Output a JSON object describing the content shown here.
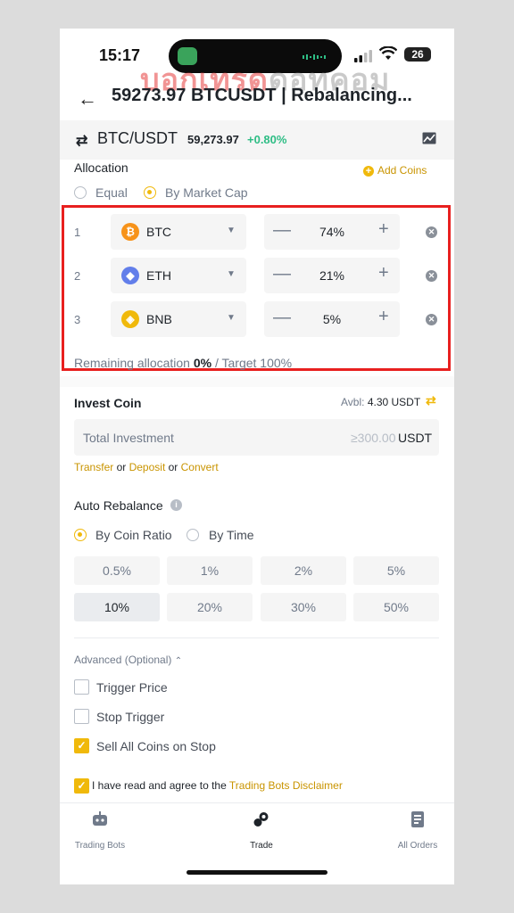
{
  "status_bar": {
    "time": "15:17",
    "battery": "26"
  },
  "watermark": {
    "part1": "บอกเทรด",
    "part2": "ดอทคอม"
  },
  "header": {
    "back_icon": "arrow-left-icon",
    "title": "59273.97 BTCUSDT | Rebalancing..."
  },
  "pair": {
    "name": "BTC/USDT",
    "price": "59,273.97",
    "change": "+0.80%"
  },
  "allocation": {
    "label": "Allocation",
    "add_coins": "Add Coins",
    "modes": [
      {
        "label": "Equal",
        "selected": false
      },
      {
        "label": "By Market Cap",
        "selected": true
      }
    ],
    "rows": [
      {
        "index": "1",
        "coin": "BTC",
        "symbol": "₿",
        "color": "#f7931a",
        "percent": "74%"
      },
      {
        "index": "2",
        "coin": "ETH",
        "symbol": "◆",
        "color": "#627eea",
        "percent": "21%"
      },
      {
        "index": "3",
        "coin": "BNB",
        "symbol": "◈",
        "color": "#f0b90b",
        "percent": "5%"
      }
    ],
    "remaining_prefix": "Remaining allocation",
    "remaining_value": "0%",
    "remaining_suffix": "/ Target 100%"
  },
  "invest": {
    "label": "Invest Coin",
    "avbl_label": "Avbl:",
    "avbl_value": "4.30 USDT",
    "placeholder": "Total Investment",
    "minimum": "≥300.00",
    "unit": "USDT",
    "link_transfer": "Transfer",
    "or1": "or",
    "link_deposit": "Deposit",
    "or2": "or",
    "link_convert": "Convert"
  },
  "auto_rebalance": {
    "label": "Auto Rebalance",
    "modes": [
      {
        "label": "By Coin Ratio",
        "selected": true
      },
      {
        "label": "By Time",
        "selected": false
      }
    ],
    "ratios": [
      "0.5%",
      "1%",
      "2%",
      "5%",
      "10%",
      "20%",
      "30%",
      "50%"
    ],
    "selected_ratio": "10%"
  },
  "advanced": {
    "label": "Advanced (Optional)",
    "options": [
      {
        "label": "Trigger Price",
        "checked": false
      },
      {
        "label": "Stop Trigger",
        "checked": false
      },
      {
        "label": "Sell All Coins on Stop",
        "checked": true
      }
    ]
  },
  "agreement": {
    "text": "I have read and agree to the",
    "link": "Trading Bots Disclaimer",
    "checked": true
  },
  "tabs": [
    {
      "label": "Trading Bots",
      "icon": "robot-icon"
    },
    {
      "label": "Trade",
      "icon": "trade-icon"
    },
    {
      "label": "All Orders",
      "icon": "orders-icon"
    }
  ],
  "colors": {
    "accent": "#f0b90b",
    "positive": "#2ebd85",
    "highlight_border": "#e8201f"
  }
}
